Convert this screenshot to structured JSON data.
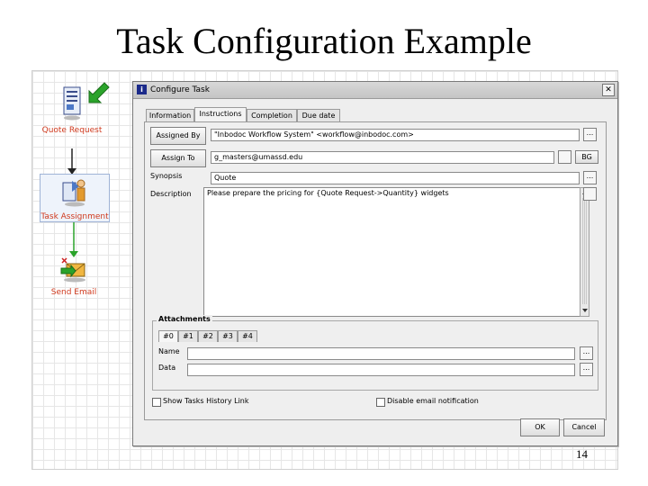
{
  "slide": {
    "title": "Task Configuration Example",
    "page_number": "14"
  },
  "workflow": {
    "nodes": [
      {
        "label": "Quote Request"
      },
      {
        "label": "Task Assignment"
      },
      {
        "label": "Send Email"
      }
    ],
    "colors": {
      "label": "#d03a1e",
      "start_arrow": "#2aa32a",
      "connector_1": "#222222",
      "connector_2": "#2aa32a"
    }
  },
  "dialog": {
    "title": "Configure Task",
    "close_glyph": "✕",
    "tabs": [
      {
        "label": "Information"
      },
      {
        "label": "Instructions",
        "active": true
      },
      {
        "label": "Completion"
      },
      {
        "label": "Due date"
      }
    ],
    "assigned_by": {
      "button_label": "Assigned By",
      "value": "\"Inbodoc Workflow System\" <workflow@inbodoc.com>",
      "browse_label": "..."
    },
    "assign_to": {
      "button_label": "Assign To",
      "value": "g_masters@umassd.edu",
      "extra_button_label": "BG"
    },
    "synopsis": {
      "label": "Synopsis",
      "value": "Quote",
      "browse_label": "..."
    },
    "description": {
      "label": "Description",
      "value": "Please prepare the pricing for {Quote Request->Quantity} widgets"
    },
    "attachments": {
      "legend": "Attachments",
      "tabs": [
        "#0",
        "#1",
        "#2",
        "#3",
        "#4"
      ],
      "name_label": "Name",
      "data_label": "Data",
      "name_value": "",
      "data_value": "",
      "browse_label": "..."
    },
    "show_history": {
      "label": "Show Tasks History Link",
      "checked": false
    },
    "disable_email": {
      "label": "Disable email notification",
      "checked": false
    },
    "ok_label": "OK",
    "cancel_label": "Cancel"
  }
}
